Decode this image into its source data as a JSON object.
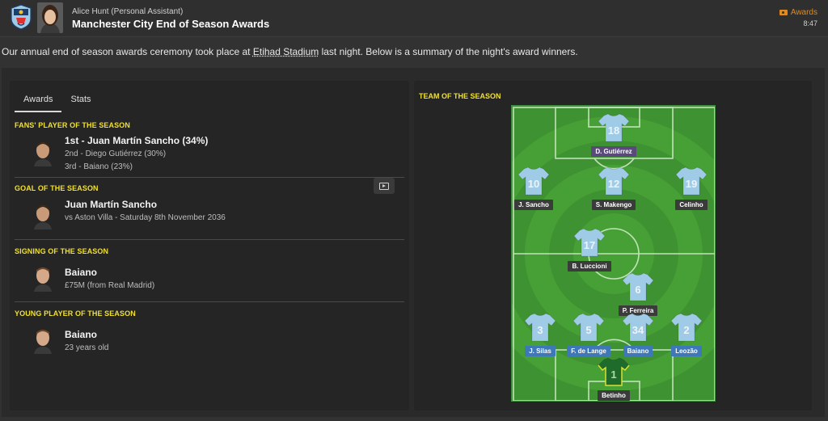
{
  "header": {
    "sender": "Alice Hunt  (Personal Assistant)",
    "subject": "Manchester City End of Season Awards",
    "tag_label": "Awards",
    "time": "8:47"
  },
  "intro": {
    "before": "Our annual end of season awards ceremony took place at ",
    "stadium": "Etihad Stadium",
    "after": " last night. Below is a summary of the night's award winners."
  },
  "tabs": [
    {
      "label": "Awards",
      "active": true
    },
    {
      "label": "Stats",
      "active": false
    }
  ],
  "awards": {
    "fans_player": {
      "heading": "FANS' PLAYER OF THE SEASON",
      "title": "1st - Juan Martín Sancho (34%)",
      "line1": "2nd - Diego Gutiérrez (30%)",
      "line2": "3rd - Baiano (23%)"
    },
    "goal": {
      "heading": "GOAL OF THE SEASON",
      "title": "Juan Martín Sancho",
      "line1": "vs Aston Villa - Saturday 8th November 2036"
    },
    "signing": {
      "heading": "SIGNING OF THE SEASON",
      "title": "Baiano",
      "line1": "£75M (from Real Madrid)"
    },
    "young": {
      "heading": "YOUNG PLAYER OF THE SEASON",
      "title": "Baiano",
      "line1": "23 years old"
    }
  },
  "team_of_season": {
    "title": "TEAM OF THE SEASON",
    "colors": {
      "shirt": "#9fcbe6",
      "keeper_shirt": "#1e6b2c",
      "name_dark": "#3b3b3b",
      "name_purple": "#5a4a7a",
      "name_blue": "#3f78b8",
      "pitch_light": "#4fa43f",
      "pitch_dark": "#3f9231"
    },
    "players": [
      {
        "key": "gutierrez",
        "number": "18",
        "name": "D. Gutiérrez",
        "style": "purple",
        "keeper": false
      },
      {
        "key": "sancho",
        "number": "10",
        "name": "J. Sancho",
        "style": "dark",
        "keeper": false
      },
      {
        "key": "makengo",
        "number": "12",
        "name": "S. Makengo",
        "style": "dark",
        "keeper": false
      },
      {
        "key": "celinho",
        "number": "19",
        "name": "Celinho",
        "style": "dark",
        "keeper": false
      },
      {
        "key": "luccioni",
        "number": "17",
        "name": "B. Luccioni",
        "style": "dark",
        "keeper": false
      },
      {
        "key": "ferreira",
        "number": "6",
        "name": "P. Ferreira",
        "style": "dark",
        "keeper": false
      },
      {
        "key": "silas",
        "number": "3",
        "name": "J. Silas",
        "style": "blue",
        "keeper": false
      },
      {
        "key": "delange",
        "number": "5",
        "name": "F. de Lange",
        "style": "blue",
        "keeper": false
      },
      {
        "key": "baiano",
        "number": "34",
        "name": "Baiano",
        "style": "blue",
        "keeper": false
      },
      {
        "key": "leozao",
        "number": "2",
        "name": "Leozão",
        "style": "blue",
        "keeper": false
      },
      {
        "key": "betinho",
        "number": "1",
        "name": "Betinho",
        "style": "dark",
        "keeper": true
      }
    ]
  }
}
